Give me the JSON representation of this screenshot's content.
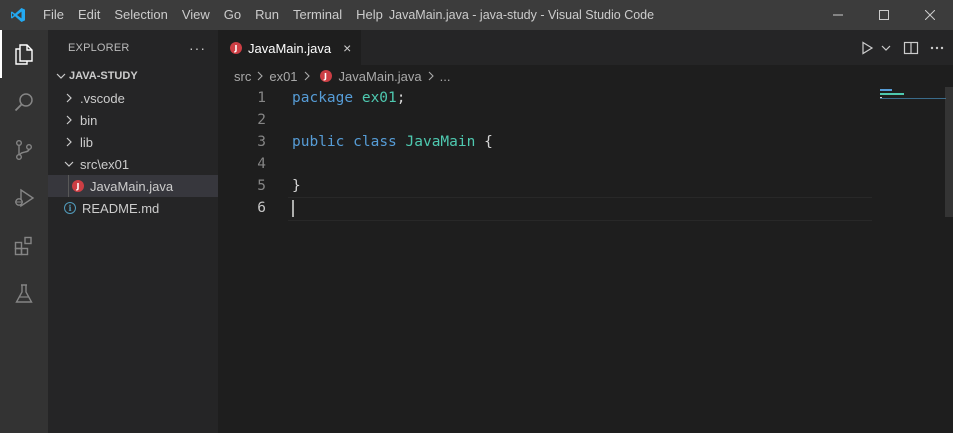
{
  "window": {
    "title": "JavaMain.java - java-study - Visual Studio Code",
    "logo_icon": "vscode-logo-icon",
    "controls": [
      "minimize-icon",
      "maximize-icon",
      "close-icon"
    ]
  },
  "menu": [
    "File",
    "Edit",
    "Selection",
    "View",
    "Go",
    "Run",
    "Terminal",
    "Help"
  ],
  "activity_bar": [
    {
      "name": "explorer-icon",
      "active": true
    },
    {
      "name": "search-icon",
      "active": false
    },
    {
      "name": "source-control-icon",
      "active": false
    },
    {
      "name": "run-debug-icon",
      "active": false
    },
    {
      "name": "extensions-icon",
      "active": false
    },
    {
      "name": "testing-icon",
      "active": false
    }
  ],
  "sidebar": {
    "title": "EXPLORER",
    "more": "···",
    "root": "JAVA-STUDY",
    "items": [
      {
        "label": ".vscode",
        "type": "folder"
      },
      {
        "label": "bin",
        "type": "folder"
      },
      {
        "label": "lib",
        "type": "folder"
      },
      {
        "label": "src\\ex01",
        "type": "folder-open"
      },
      {
        "label": "JavaMain.java",
        "type": "java-file"
      },
      {
        "label": "README.md",
        "type": "info-file"
      }
    ]
  },
  "editor": {
    "tab": {
      "label": "JavaMain.java",
      "close": "×"
    },
    "breadcrumb": [
      "src",
      "ex01",
      "JavaMain.java",
      "..."
    ],
    "lines": [
      {
        "no": "1",
        "tokens": [
          {
            "t": "package",
            "c": "kw"
          },
          {
            "t": " ",
            "c": "pl"
          },
          {
            "t": "ex01",
            "c": "ty"
          },
          {
            "t": ";",
            "c": "pl"
          }
        ]
      },
      {
        "no": "2",
        "tokens": []
      },
      {
        "no": "3",
        "tokens": [
          {
            "t": "public",
            "c": "kw"
          },
          {
            "t": " ",
            "c": "pl"
          },
          {
            "t": "class",
            "c": "kw"
          },
          {
            "t": " ",
            "c": "pl"
          },
          {
            "t": "JavaMain",
            "c": "ty"
          },
          {
            "t": " {",
            "c": "pl"
          }
        ]
      },
      {
        "no": "4",
        "tokens": []
      },
      {
        "no": "5",
        "tokens": [
          {
            "t": "}",
            "c": "pl"
          }
        ]
      },
      {
        "no": "6",
        "tokens": []
      }
    ],
    "current_line": 6
  },
  "colors": {
    "keyword": "#569cd6",
    "type": "#4ec9b0",
    "plain": "#d4d4d4",
    "accent": "#007acc",
    "java_icon": "#cc3e44"
  }
}
